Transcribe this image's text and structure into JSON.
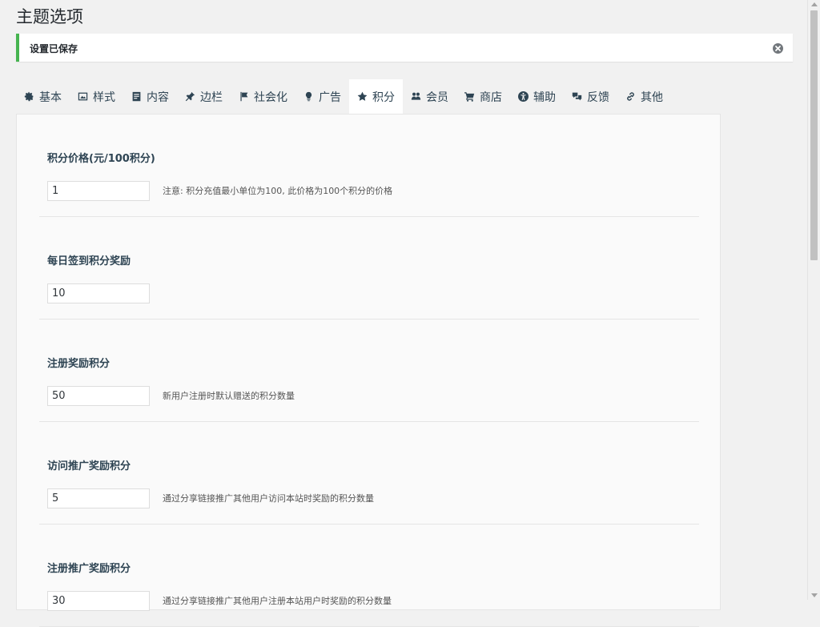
{
  "page": {
    "title": "主题选项"
  },
  "notice": {
    "text": "设置已保存",
    "close_icon": "close-circle-icon",
    "accent_color": "#46b450"
  },
  "tabs": [
    {
      "label": "基本",
      "icon": "gear-icon",
      "active": false
    },
    {
      "label": "样式",
      "icon": "image-icon",
      "active": false
    },
    {
      "label": "内容",
      "icon": "document-icon",
      "active": false
    },
    {
      "label": "边栏",
      "icon": "pin-icon",
      "active": false
    },
    {
      "label": "社会化",
      "icon": "flag-icon",
      "active": false
    },
    {
      "label": "广告",
      "icon": "lightbulb-icon",
      "active": false
    },
    {
      "label": "积分",
      "icon": "star-icon",
      "active": true
    },
    {
      "label": "会员",
      "icon": "users-icon",
      "active": false
    },
    {
      "label": "商店",
      "icon": "cart-icon",
      "active": false
    },
    {
      "label": "辅助",
      "icon": "accessibility-icon",
      "active": false
    },
    {
      "label": "反馈",
      "icon": "chat-icon",
      "active": false
    },
    {
      "label": "其他",
      "icon": "link-icon",
      "active": false
    }
  ],
  "fields": [
    {
      "label": "积分价格(元/100积分)",
      "value": "1",
      "description": "注意: 积分充值最小单位为100, 此价格为100个积分的价格"
    },
    {
      "label": "每日签到积分奖励",
      "value": "10",
      "description": ""
    },
    {
      "label": "注册奖励积分",
      "value": "50",
      "description": "新用户注册时默认赠送的积分数量"
    },
    {
      "label": "访问推广奖励积分",
      "value": "5",
      "description": "通过分享链接推广其他用户访问本站时奖励的积分数量"
    },
    {
      "label": "注册推广奖励积分",
      "value": "30",
      "description": "通过分享链接推广其他用户注册本站用户时奖励的积分数量"
    }
  ]
}
